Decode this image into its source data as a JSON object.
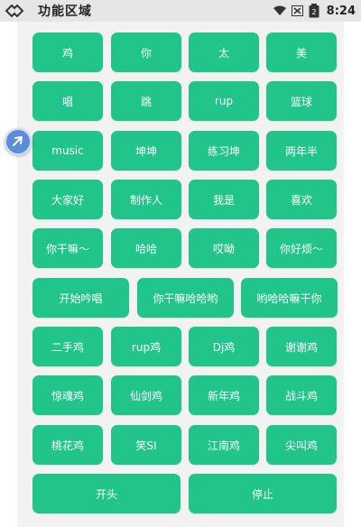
{
  "status_bar": {
    "title": "功能区域",
    "battery_level": "2",
    "time": "8:24"
  },
  "colors": {
    "button": "#21c489",
    "panel": "#f2f2f2",
    "status_bar": "#e6e6e6"
  },
  "buttons": {
    "r1": [
      "鸡",
      "你",
      "太",
      "美"
    ],
    "r2": [
      "唱",
      "跳",
      "rup",
      "篮球"
    ],
    "r3": [
      "music",
      "坤坤",
      "练习坤",
      "两年半"
    ],
    "r4": [
      "大家好",
      "制作人",
      "我是",
      "喜欢"
    ],
    "r5": [
      "你干嘛～",
      "哈哈",
      "哎呦",
      "你好烦～"
    ],
    "r6": [
      "开始吟唱",
      "你干嘛哈哈哟",
      "哟哈哈嘛干你"
    ],
    "r7": [
      "二手鸡",
      "rup鸡",
      "Dj鸡",
      "谢谢鸡"
    ],
    "r8": [
      "惊魂鸡",
      "仙剑鸡",
      "新年鸡",
      "战斗鸡"
    ],
    "r9": [
      "桃花鸡",
      "笑SI",
      "江南鸡",
      "尖叫鸡"
    ],
    "r10": [
      "开头",
      "停止"
    ]
  }
}
